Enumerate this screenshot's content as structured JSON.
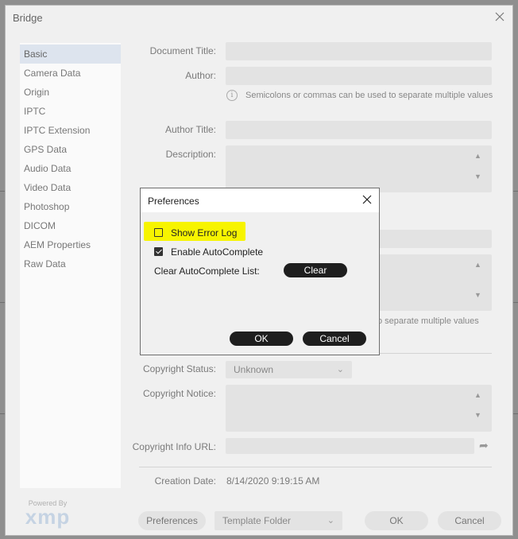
{
  "window": {
    "title": "Bridge"
  },
  "sidebar": {
    "items": [
      {
        "label": "Basic"
      },
      {
        "label": "Camera Data"
      },
      {
        "label": "Origin"
      },
      {
        "label": "IPTC"
      },
      {
        "label": "IPTC Extension"
      },
      {
        "label": "GPS Data"
      },
      {
        "label": "Audio Data"
      },
      {
        "label": "Video Data"
      },
      {
        "label": "Photoshop"
      },
      {
        "label": "DICOM"
      },
      {
        "label": "AEM Properties"
      },
      {
        "label": "Raw Data"
      }
    ]
  },
  "xmp": {
    "powered_by": "Powered By",
    "logo": "xmp"
  },
  "form": {
    "document_title_label": "Document Title:",
    "document_title_value": "",
    "author_label": "Author:",
    "author_value": "",
    "separator_hint": "Semicolons or commas can be used to separate multiple values",
    "author_title_label": "Author Title:",
    "author_title_value": "",
    "description_label": "Description:",
    "description_value": "",
    "separator_hint_partial": "o separate multiple values",
    "copyright_status_label": "Copyright Status:",
    "copyright_status_value": "Unknown",
    "copyright_notice_label": "Copyright Notice:",
    "copyright_notice_value": "",
    "copyright_url_label": "Copyright Info URL:",
    "copyright_url_value": "",
    "creation_date_label": "Creation Date:",
    "creation_date_value": "8/14/2020 9:19:15 AM"
  },
  "footer": {
    "preferences_label": "Preferences",
    "template_folder_label": "Template Folder",
    "ok_label": "OK",
    "cancel_label": "Cancel"
  },
  "dialog": {
    "title": "Preferences",
    "show_error_log_label": "Show Error Log",
    "show_error_log_checked": false,
    "enable_autocomplete_label": "Enable AutoComplete",
    "enable_autocomplete_checked": true,
    "clear_list_label": "Clear AutoComplete List:",
    "clear_button_label": "Clear",
    "ok_label": "OK",
    "cancel_label": "Cancel"
  },
  "colors": {
    "highlight": "#f7f400",
    "dialog_button_bg": "#1e1e1e",
    "active_sidebar_bg": "#dde4ee"
  }
}
